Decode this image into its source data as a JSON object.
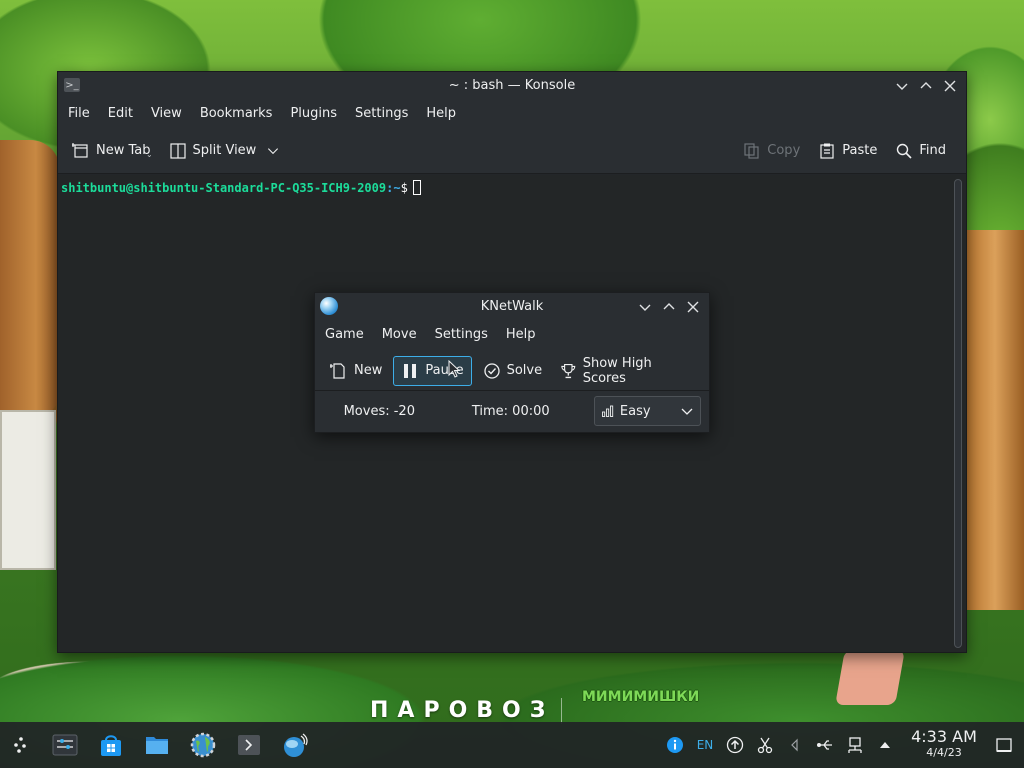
{
  "wallpaper": {
    "logo_text": "ПАРОВОЗ",
    "logo2_text": "МИМИМИШКИ"
  },
  "konsole": {
    "title": "~ : bash — Konsole",
    "menu": [
      "File",
      "Edit",
      "View",
      "Bookmarks",
      "Plugins",
      "Settings",
      "Help"
    ],
    "toolbar": {
      "new_tab": "New Tab",
      "split_view": "Split View",
      "copy": "Copy",
      "paste": "Paste",
      "find": "Find"
    },
    "terminal": {
      "user_host": "shitbuntu@shitbuntu-Standard-PC-Q35-ICH9-2009",
      "path": ":~",
      "prompt_symbol": "$"
    }
  },
  "knetwalk": {
    "title": "KNetWalk",
    "menu": [
      "Game",
      "Move",
      "Settings",
      "Help"
    ],
    "toolbar": {
      "new": "New",
      "pause": "Pause",
      "solve": "Solve",
      "high_scores": "Show High Scores"
    },
    "status": {
      "moves": "Moves: -20",
      "time": "Time: 00:00",
      "difficulty": "Easy"
    }
  },
  "taskbar": {
    "language": "EN",
    "clock_time": "4:33 AM",
    "clock_date": "4/4/23"
  },
  "colors": {
    "accent": "#3daee9",
    "prompt_user": "#1cdc9a",
    "window_bg": "#2a2e32",
    "terminal_bg": "#232627"
  }
}
